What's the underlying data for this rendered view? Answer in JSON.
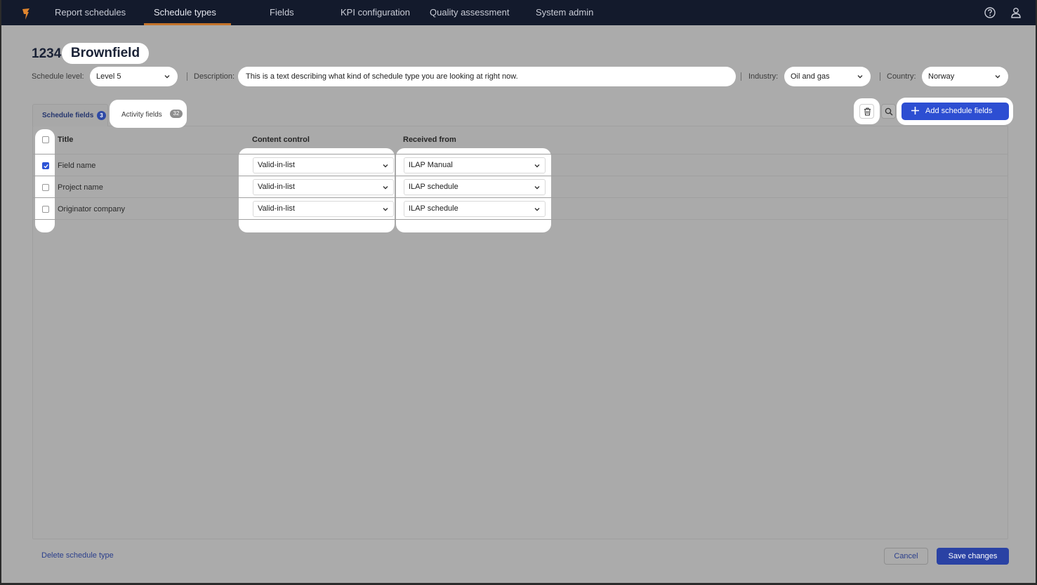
{
  "nav": {
    "items": [
      "Report schedules",
      "Schedule types",
      "Fields",
      "KPI configuration",
      "Quality assessment",
      "System admin"
    ],
    "active": "Schedule types",
    "icons": [
      "help-icon",
      "user-icon"
    ]
  },
  "header": {
    "number": "1234",
    "name": "Brownfield",
    "schedule_level_label": "Schedule level:",
    "schedule_level_value": "Level 5",
    "description_label": "Description:",
    "description_value": "This is a text describing what kind of  schedule type you are looking at right now.",
    "industry_label": "Industry:",
    "industry_value": "Oil and gas",
    "country_label": "Country:",
    "country_value": "Norway"
  },
  "tabs": [
    {
      "label": "Schedule fields",
      "count": "3",
      "active": true
    },
    {
      "label": "Activity fields",
      "count": "32",
      "active": false
    }
  ],
  "toolbar": {
    "add_label": "Add schedule fields"
  },
  "table": {
    "columns": [
      "Title",
      "Content control",
      "Received from"
    ],
    "rows": [
      {
        "title": "Field name",
        "checked": true,
        "content_control": "Valid-in-list",
        "received_from": "ILAP Manual"
      },
      {
        "title": "Project name",
        "checked": false,
        "content_control": "Valid-in-list",
        "received_from": "ILAP schedule"
      },
      {
        "title": "Originator company",
        "checked": false,
        "content_control": "Valid-in-list",
        "received_from": "ILAP schedule"
      }
    ]
  },
  "footer": {
    "delete_label": "Delete schedule type",
    "cancel_label": "Cancel",
    "save_label": "Save changes"
  },
  "colors": {
    "nav_bg": "#131a2c",
    "accent_orange": "#c4732a",
    "primary_blue": "#2d4ed2",
    "save_blue": "#2a42a4",
    "overlay_grey": "#ababab"
  }
}
